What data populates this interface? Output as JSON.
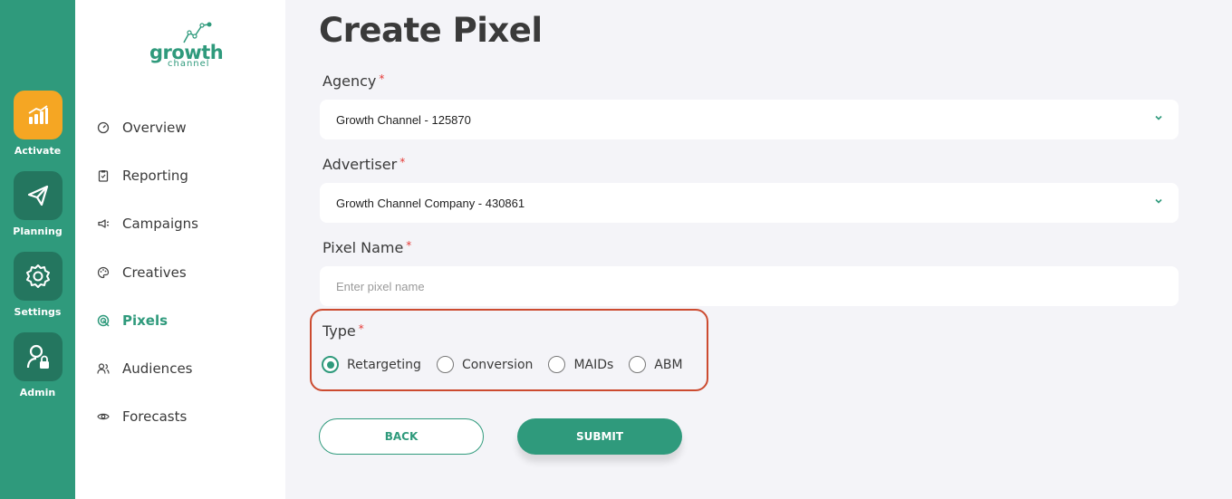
{
  "rail": {
    "items": [
      {
        "label": "Activate",
        "icon": "chart-bars-icon",
        "active": true
      },
      {
        "label": "Planning",
        "icon": "paper-plane-icon",
        "active": false
      },
      {
        "label": "Settings",
        "icon": "gear-icon",
        "active": false
      },
      {
        "label": "Admin",
        "icon": "user-lock-icon",
        "active": false
      }
    ]
  },
  "brand": {
    "word": "growth",
    "sub": "channel",
    "color": "#2f9a7c"
  },
  "sidebar": {
    "items": [
      {
        "label": "Overview",
        "icon": "speedometer-icon"
      },
      {
        "label": "Reporting",
        "icon": "clipboard-icon"
      },
      {
        "label": "Campaigns",
        "icon": "megaphone-icon"
      },
      {
        "label": "Creatives",
        "icon": "palette-icon"
      },
      {
        "label": "Pixels",
        "icon": "target-icon",
        "active": true
      },
      {
        "label": "Audiences",
        "icon": "users-icon"
      },
      {
        "label": "Forecasts",
        "icon": "eye-icon"
      }
    ]
  },
  "main": {
    "title": "Create Pixel",
    "agency": {
      "label": "Agency",
      "required": "*",
      "value": "Growth Channel - 125870"
    },
    "advertiser": {
      "label": "Advertiser",
      "required": "*",
      "value": "Growth Channel Company - 430861"
    },
    "pixel_name": {
      "label": "Pixel Name",
      "required": "*",
      "placeholder": "Enter pixel name",
      "value": ""
    },
    "type": {
      "label": "Type",
      "required": "*",
      "options": [
        "Retargeting",
        "Conversion",
        "MAIDs",
        "ABM"
      ],
      "selected": "Retargeting"
    },
    "back_label": "BACK",
    "submit_label": "SUBMIT"
  },
  "colors": {
    "accent": "#2f9a7c",
    "rail_active": "#f5a623",
    "highlight": "#cc4b30",
    "required": "#e53935"
  }
}
